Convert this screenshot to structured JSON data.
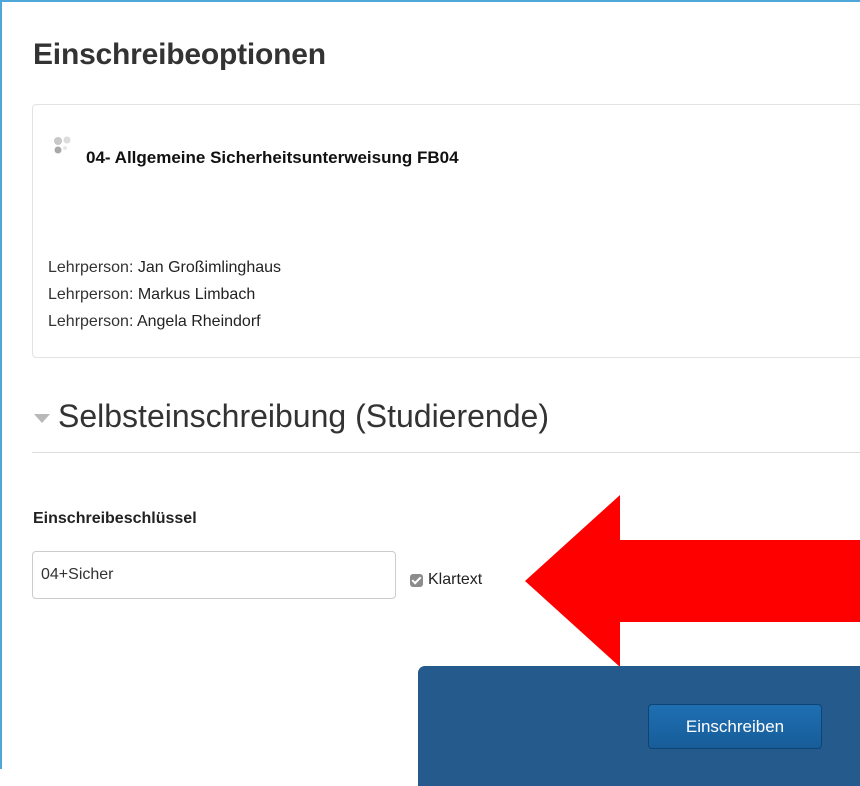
{
  "page": {
    "title": "Einschreibeoptionen"
  },
  "course": {
    "name": "04- Allgemeine Sicherheitsunterweisung FB04",
    "icon": "course-icon",
    "teachers": [
      {
        "role": "Lehrperson: ",
        "name": "Jan Großimlinghaus"
      },
      {
        "role": "Lehrperson: ",
        "name": "Markus Limbach"
      },
      {
        "role": "Lehrperson: ",
        "name": "Angela Rheindorf"
      }
    ]
  },
  "self_enrolment": {
    "heading": "Selbsteinschreibung (Studierende)",
    "key_label": "Einschreibeschlüssel",
    "key_value": "04+Sicher",
    "unmask_label": "Klartext",
    "unmask_checked": true,
    "submit_label": "Einschreiben"
  },
  "colors": {
    "accent_frame": "#4fa7d8",
    "footer_panel": "#245a8c",
    "button": "#1e6fb3",
    "annotation_arrow": "#ff0000"
  }
}
